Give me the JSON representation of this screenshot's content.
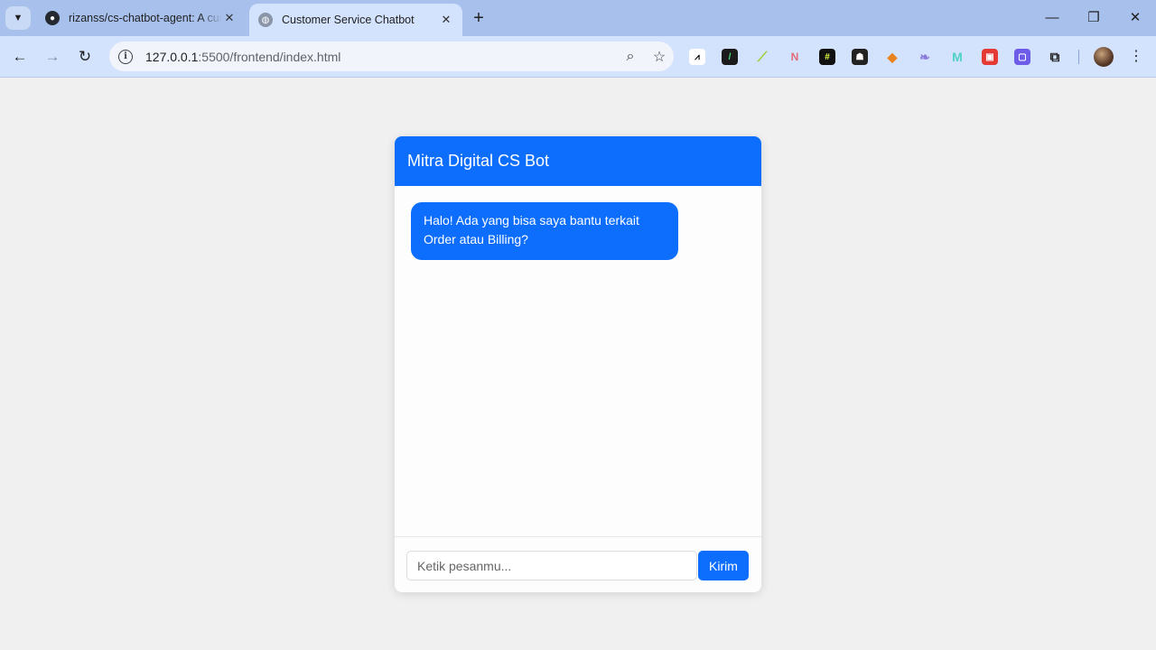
{
  "browser": {
    "tabs": [
      {
        "title": "rizanss/cs-chatbot-agent: A cus",
        "active": false
      },
      {
        "title": "Customer Service Chatbot",
        "active": true
      }
    ],
    "new_tab_symbol": "+",
    "address_bar": {
      "host": "127.0.0.1",
      "path": ":5500/frontend/index.html"
    },
    "extensions": [
      "activity-icon",
      "terminal-icon",
      "leaf-icon",
      "n8n-icon",
      "hashtag-icon",
      "ghost-icon",
      "metamask-icon",
      "feather-icon",
      "m-icon",
      "lock-icon",
      "square-icon",
      "puzzle-icon"
    ]
  },
  "chat": {
    "header_title": "Mitra Digital CS Bot",
    "messages": [
      {
        "sender": "bot",
        "text": "Halo! Ada yang bisa saya bantu terkait Order atau Billing?"
      }
    ],
    "input_placeholder": "Ketik pesanmu...",
    "input_value": "",
    "send_label": "Kirim",
    "accent_color": "#0d6efd"
  }
}
